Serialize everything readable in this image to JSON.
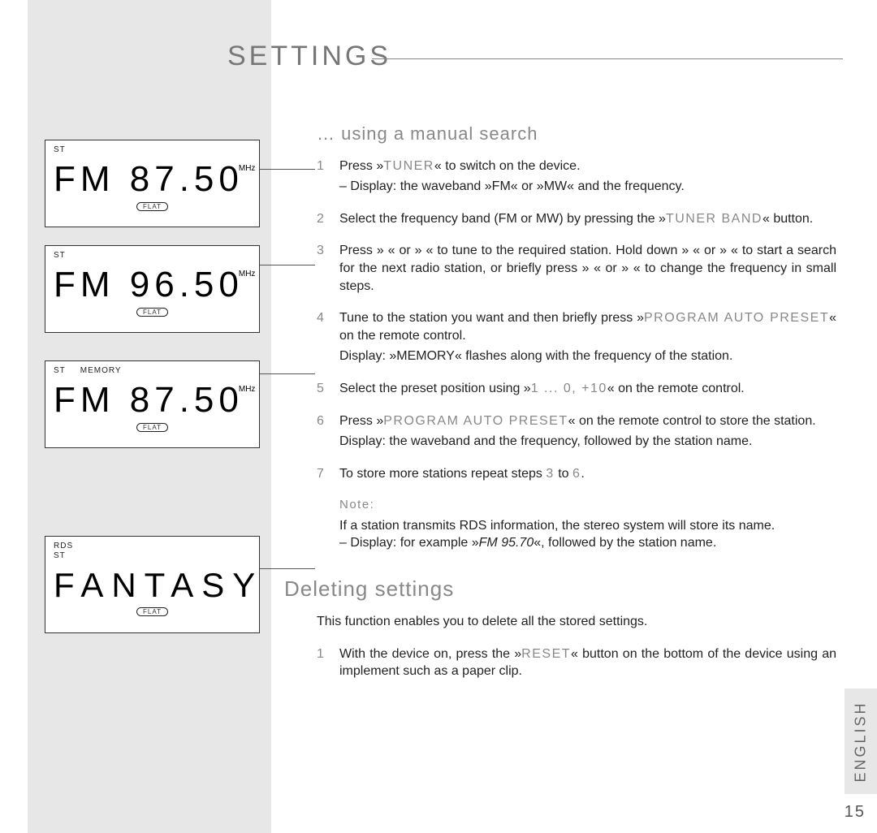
{
  "page": {
    "title": "SETTINGS",
    "language_tab": "ENGLISH",
    "page_number": "15"
  },
  "panels": [
    {
      "indicators": [
        "ST"
      ],
      "main": "FM  87.50",
      "unit": "MHz",
      "badge": "FLAT"
    },
    {
      "indicators": [
        "ST"
      ],
      "main": "FM  96.50",
      "unit": "MHz",
      "badge": "FLAT"
    },
    {
      "indicators": [
        "ST",
        "MEMORY"
      ],
      "main": "FM  87.50",
      "unit": "MHz",
      "badge": "FLAT"
    },
    {
      "indicators": [
        "RDS",
        "ST"
      ],
      "main": "FANTASY",
      "unit": "",
      "badge": "FLAT"
    }
  ],
  "section_manual": {
    "heading": "… using a manual search",
    "steps": [
      {
        "pre": "Press »",
        "btn": "TUNER",
        "post": "« to switch on the device.",
        "sub": "– Display: the waveband »FM« or »MW« and the frequency."
      },
      {
        "text_a": "Select the frequency band (FM or MW) by pressing the »",
        "btn": "TUNER BAND",
        "text_b": "« button."
      },
      {
        "line1": "Press »        « or »        « to tune to the required station. Hold down »        « or »        « to start a search for the next radio station, or briefly press »        « or »        « to change the frequency in small steps."
      },
      {
        "text_a": "Tune to the station you want and then briefly press »",
        "btn": "PROGRAM AUTO PRESET",
        "text_b": "« on the remote control.",
        "sub": "Display: »MEMORY« flashes along with the frequency of the station."
      },
      {
        "text_a": "Select the preset position using »",
        "btn": "1 ... 0, +10",
        "text_b": "« on the remote control."
      },
      {
        "text_a": "Press »",
        "btn": "PROGRAM AUTO PRESET",
        "text_b": "« on the remote control to store the station.",
        "sub": "Display: the waveband and the frequency, followed by the station name."
      },
      {
        "text_a": "To store more stations repeat steps ",
        "btn": "3",
        "mid": " to ",
        "btn2": "6",
        "text_b": "."
      }
    ],
    "note_head": "Note:",
    "note_l1": "If a station transmits RDS information, the stereo system will store its name.",
    "note_l2a": "– Display: for example »",
    "note_l2b": "FM 95.70",
    "note_l2c": "«, followed by the station name."
  },
  "section_delete": {
    "heading": "Deleting settings",
    "intro": "This function enables you to delete all the stored settings.",
    "step1_a": "With the device on, press the »",
    "step1_btn": "RESET",
    "step1_b": "« button on the bottom of the device using an implement such as a paper clip."
  }
}
